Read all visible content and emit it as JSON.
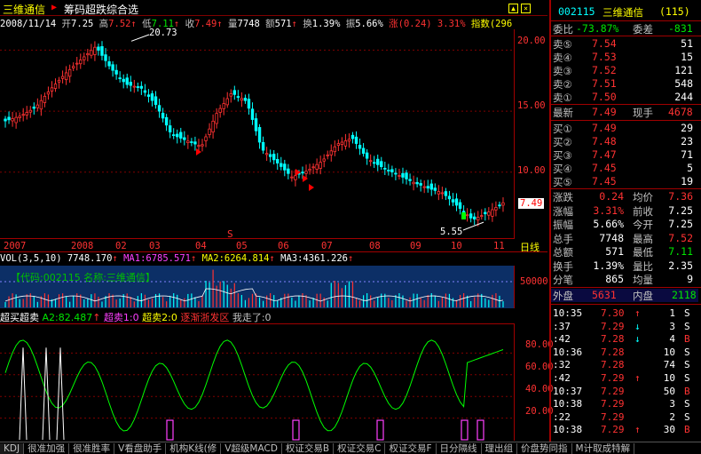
{
  "header": {
    "stock_name": "三维通信",
    "tool": "筹码超跌综合选"
  },
  "info": {
    "date": "2008/11/14",
    "open_l": "开",
    "open": "7.25",
    "high_l": "高",
    "high": "7.52",
    "low_l": "低",
    "low": "7.11",
    "close_l": "收",
    "close": "7.49",
    "vol_l": "量",
    "vol": "7748",
    "amt_l": "额",
    "amt": "571",
    "turn_l": "换",
    "turn": "1.39%",
    "amp_l": "振",
    "amp": "5.66%",
    "chg_l": "涨",
    "chg": "(0.24)",
    "chg_pct": "3.31%",
    "idx_l": "指数",
    "idx": "(296"
  },
  "kchart": {
    "y_ticks": [
      "20.00",
      "15.00",
      "10.00"
    ],
    "y_values": [
      20,
      15,
      10
    ],
    "ylim": [
      4.6,
      21.7
    ],
    "high_label": "20.73",
    "low_label": "5.55",
    "last_price": "7.49",
    "mark_s": "S"
  },
  "dates": {
    "labels": [
      "2007",
      "2008",
      "02",
      "03",
      "04",
      "05",
      "06",
      "07",
      "08",
      "09",
      "10",
      "11"
    ],
    "period": "日线"
  },
  "vol": {
    "title": "VOL(3,5,10)",
    "v": "7748.170",
    "ma1": "MA1:6785.571",
    "ma2": "MA2:6264.814",
    "ma3": "MA3:4361.226",
    "tick": "50000",
    "code_box": "【代码:002115 名称:三维通信】"
  },
  "ind": {
    "title": "超买超卖",
    "a2": "A2:82.487",
    "chaomai1": "超卖1:0",
    "chaomai2": "超卖2:0",
    "zone": "逐渐浙发区",
    "exit": "我走了:0",
    "ticks": [
      "80.00",
      "60.00",
      "40.00",
      "20.00"
    ],
    "tick_values": [
      80,
      60,
      40,
      20
    ]
  },
  "chart_data": {
    "type": "line",
    "title": "三维通信 日线",
    "xlabel": "",
    "ylabel": "",
    "series": [
      {
        "name": "收",
        "values": [
          14.2,
          14.6,
          15.3,
          16.8,
          18.1,
          19.2,
          20.3,
          18.5,
          17.2,
          16.9,
          15.5,
          13.1,
          12.6,
          12.1,
          14.8,
          16.5,
          15.8,
          11.9,
          10.8,
          9.6,
          10.1,
          10.9,
          12.3,
          12.8,
          11.1,
          10.4,
          9.8,
          9.2,
          8.7,
          8.3,
          7.2,
          6.1,
          6.7,
          7.49
        ]
      }
    ]
  },
  "quote": {
    "code": "002115",
    "name": "三维通信",
    "count": "(115)",
    "wb_l": "委比",
    "wb": "-73.87%",
    "wc_l": "委差",
    "wc": "-831",
    "sell": [
      {
        "l": "卖⑤",
        "p": "7.54",
        "v": "51"
      },
      {
        "l": "卖④",
        "p": "7.53",
        "v": "15"
      },
      {
        "l": "卖③",
        "p": "7.52",
        "v": "121"
      },
      {
        "l": "卖②",
        "p": "7.51",
        "v": "548"
      },
      {
        "l": "卖①",
        "p": "7.50",
        "v": "244"
      }
    ],
    "last_l": "最新",
    "last": "7.49",
    "cur_l": "现手",
    "cur": "4678",
    "buy": [
      {
        "l": "买①",
        "p": "7.49",
        "v": "29"
      },
      {
        "l": "买②",
        "p": "7.48",
        "v": "23"
      },
      {
        "l": "买③",
        "p": "7.47",
        "v": "71"
      },
      {
        "l": "买④",
        "p": "7.45",
        "v": "5"
      },
      {
        "l": "买⑤",
        "p": "7.45",
        "v": "19"
      }
    ],
    "stats": [
      {
        "l1": "涨跌",
        "v1": "0.24",
        "c1": "red",
        "l2": "均价",
        "v2": "7.36",
        "c2": "red"
      },
      {
        "l1": "涨幅",
        "v1": "3.31%",
        "c1": "red",
        "l2": "前收",
        "v2": "7.25",
        "c2": "wht"
      },
      {
        "l1": "振幅",
        "v1": "5.66%",
        "c1": "wht",
        "l2": "今开",
        "v2": "7.25",
        "c2": "wht"
      },
      {
        "l1": "总手",
        "v1": "7748",
        "c1": "wht",
        "l2": "最高",
        "v2": "7.52",
        "c2": "red"
      },
      {
        "l1": "总额",
        "v1": "571",
        "c1": "wht",
        "l2": "最低",
        "v2": "7.11",
        "c2": "grn"
      },
      {
        "l1": "换手",
        "v1": "1.39%",
        "c1": "wht",
        "l2": "量比",
        "v2": "2.35",
        "c2": "wht"
      },
      {
        "l1": "分笔",
        "v1": "865",
        "c1": "wht",
        "l2": "均量",
        "v2": "9",
        "c2": "wht"
      }
    ],
    "out_l": "外盘",
    "out": "5631",
    "in_l": "内盘",
    "in": "2118"
  },
  "ticks_list": [
    {
      "t": "10:35",
      "p": "7.30",
      "a": "↑",
      "v": "1",
      "s": "S"
    },
    {
      "t": ":37",
      "p": "7.29",
      "a": "↓",
      "v": "3",
      "s": "S"
    },
    {
      "t": ":42",
      "p": "7.28",
      "a": "↓",
      "v": "4",
      "s": "B"
    },
    {
      "t": "10:36",
      "p": "7.28",
      "a": "",
      "v": "10",
      "s": "S"
    },
    {
      "t": ":32",
      "p": "7.28",
      "a": "",
      "v": "74",
      "s": "S"
    },
    {
      "t": ":42",
      "p": "7.29",
      "a": "↑",
      "v": "10",
      "s": "S"
    },
    {
      "t": "10:37",
      "p": "7.29",
      "a": "",
      "v": "50",
      "s": "B"
    },
    {
      "t": "10:38",
      "p": "7.29",
      "a": "",
      "v": "3",
      "s": "S"
    },
    {
      "t": ":22",
      "p": "7.29",
      "a": "",
      "v": "2",
      "s": "S"
    },
    {
      "t": "10:38",
      "p": "7.29",
      "a": "↑",
      "v": "30",
      "s": "B"
    }
  ],
  "tabs": [
    "KDJ",
    "很准加强",
    "很准胜率",
    "V看盘助手",
    "机构K线(修",
    "V超级MACD",
    "权证交易B",
    "权证交易C",
    "权证交易F",
    "日分隔线",
    "理出组",
    "价盘势同指",
    "M计取成特解"
  ]
}
